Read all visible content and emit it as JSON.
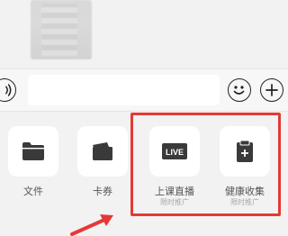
{
  "input": {
    "value": "",
    "placeholder": ""
  },
  "icons": {
    "voice": "voice-wave-icon",
    "emoji": "emoji-icon",
    "plus": "plus-circle-icon",
    "file": "folder-icon",
    "card": "card-wallet-icon",
    "live": "live-badge-icon",
    "health": "clipboard-plus-icon"
  },
  "tiles": [
    {
      "label": "文件",
      "sub": ""
    },
    {
      "label": "卡券",
      "sub": ""
    },
    {
      "label": "上课直播",
      "sub": "限时推广",
      "badge": "LIVE"
    },
    {
      "label": "健康收集",
      "sub": "限时推广"
    }
  ],
  "colors": {
    "highlight": "#e53935",
    "icon_dark": "#3a3a3a"
  }
}
